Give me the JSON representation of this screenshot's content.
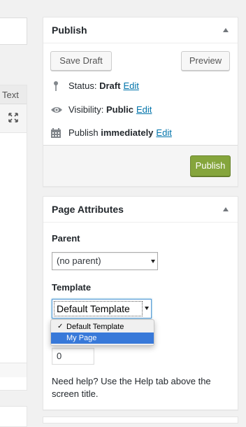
{
  "editor": {
    "text_tab": "Text",
    "expand_icon": "fullscreen-expand-icon"
  },
  "publish": {
    "title": "Publish",
    "save_draft": "Save Draft",
    "preview": "Preview",
    "status_label": "Status:",
    "status_value": "Draft",
    "visibility_label": "Visibility:",
    "visibility_value": "Public",
    "publish_label": "Publish",
    "publish_value": "immediately",
    "edit_link": "Edit",
    "publish_button": "Publish",
    "icons": {
      "status": "pin-icon",
      "visibility": "eye-icon",
      "schedule": "calendar-icon"
    },
    "colors": {
      "publish_button": "#85a53c",
      "link": "#0073aa"
    }
  },
  "attributes": {
    "title": "Page Attributes",
    "parent_label": "Parent",
    "parent_value": "(no parent)",
    "template_label": "Template",
    "template_value": "Default Template",
    "template_options": [
      {
        "label": "Default Template",
        "checked": true,
        "highlighted": false
      },
      {
        "label": "My Page",
        "checked": false,
        "highlighted": true
      }
    ],
    "order_value": "0",
    "help_text": "Need help? Use the Help tab above the screen title."
  }
}
